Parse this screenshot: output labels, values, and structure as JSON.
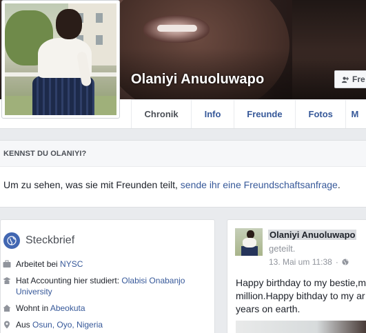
{
  "profile": {
    "name": "Olaniyi Anuoluwapo",
    "friend_button_label": "Fre"
  },
  "tabs": [
    {
      "label": "Chronik",
      "active": true
    },
    {
      "label": "Info",
      "active": false
    },
    {
      "label": "Freunde",
      "active": false
    },
    {
      "label": "Fotos",
      "active": false
    },
    {
      "label": "M",
      "active": false
    }
  ],
  "kennst": {
    "heading": "KENNST DU OLANIYI?",
    "text": "Um zu sehen, was sie mit Freunden teilt, ",
    "link": "sende ihr eine Freundschaftsanfrage",
    "suffix": "."
  },
  "intro": {
    "title": "Steckbrief",
    "items": [
      {
        "icon": "briefcase-icon",
        "prefix": "Arbeitet bei ",
        "link": "NYSC",
        "suffix": ""
      },
      {
        "icon": "school-icon",
        "prefix": "Hat Accounting hier studiert: ",
        "link": "Olabisi Onabanjo University",
        "suffix": ""
      },
      {
        "icon": "home-icon",
        "prefix": "Wohnt in ",
        "link": "Abeokuta",
        "suffix": ""
      },
      {
        "icon": "location-icon",
        "prefix": "Aus ",
        "link": "Osun, Oyo, Nigeria",
        "suffix": ""
      }
    ]
  },
  "post": {
    "author": "Olaniyi Anuoluwapo",
    "action": "geteilt.",
    "date": "13. Mai um 11:38",
    "separator": "·",
    "privacy_icon": "globe-icon",
    "text": "Happy birthday to my bestie,m\nmillion.Happy bithday to my ar\nyears on earth."
  },
  "colors": {
    "link": "#365899",
    "accent": "#4267b2",
    "background": "#e9ebee"
  }
}
